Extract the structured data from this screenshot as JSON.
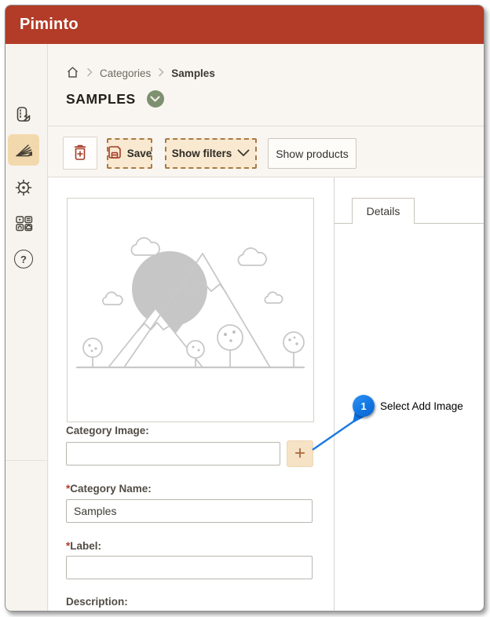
{
  "header": {
    "app_title": "Piminto"
  },
  "sidebar": {
    "items": [
      {
        "name": "catalog",
        "icon": "catalog-icon",
        "active": false
      },
      {
        "name": "categories",
        "icon": "categories-icon",
        "active": true
      },
      {
        "name": "settings",
        "icon": "gear-icon",
        "active": false
      },
      {
        "name": "media",
        "icon": "media-grid-icon",
        "active": false
      },
      {
        "name": "help",
        "icon": "help-icon",
        "active": false
      }
    ],
    "help_glyph": "?"
  },
  "breadcrumb": {
    "items": [
      "Categories",
      "Samples"
    ]
  },
  "page": {
    "title": "SAMPLES",
    "status_icon": "check-chevron-badge"
  },
  "toolbar": {
    "delete_icon": "trash-icon",
    "save_label": "Save",
    "show_filters_label": "Show filters",
    "show_products_label": "Show products"
  },
  "form": {
    "fields": [
      {
        "label": "Category Image:",
        "required_mark": "",
        "value": "",
        "has_add_button": true
      },
      {
        "label": "Category Name:",
        "required_mark": "*",
        "value": "Samples"
      },
      {
        "label": "Label:",
        "required_mark": "*",
        "value": ""
      },
      {
        "label": "Description:",
        "required_mark": ""
      }
    ],
    "add_button_glyph": "+"
  },
  "panel": {
    "tab_label": "Details"
  },
  "annotation": {
    "number": "1",
    "label": "Select Add Image"
  },
  "colors": {
    "header_red": "#b23c28",
    "active_tan": "#f2d9ad",
    "button_tan": "#f8e9d0",
    "dashed_border_brown": "#a97a45",
    "icon_maroon": "#a43b28",
    "badge_green": "#7d9070",
    "annotation_blue": "#1176e4",
    "required_red": "#b3372a"
  }
}
